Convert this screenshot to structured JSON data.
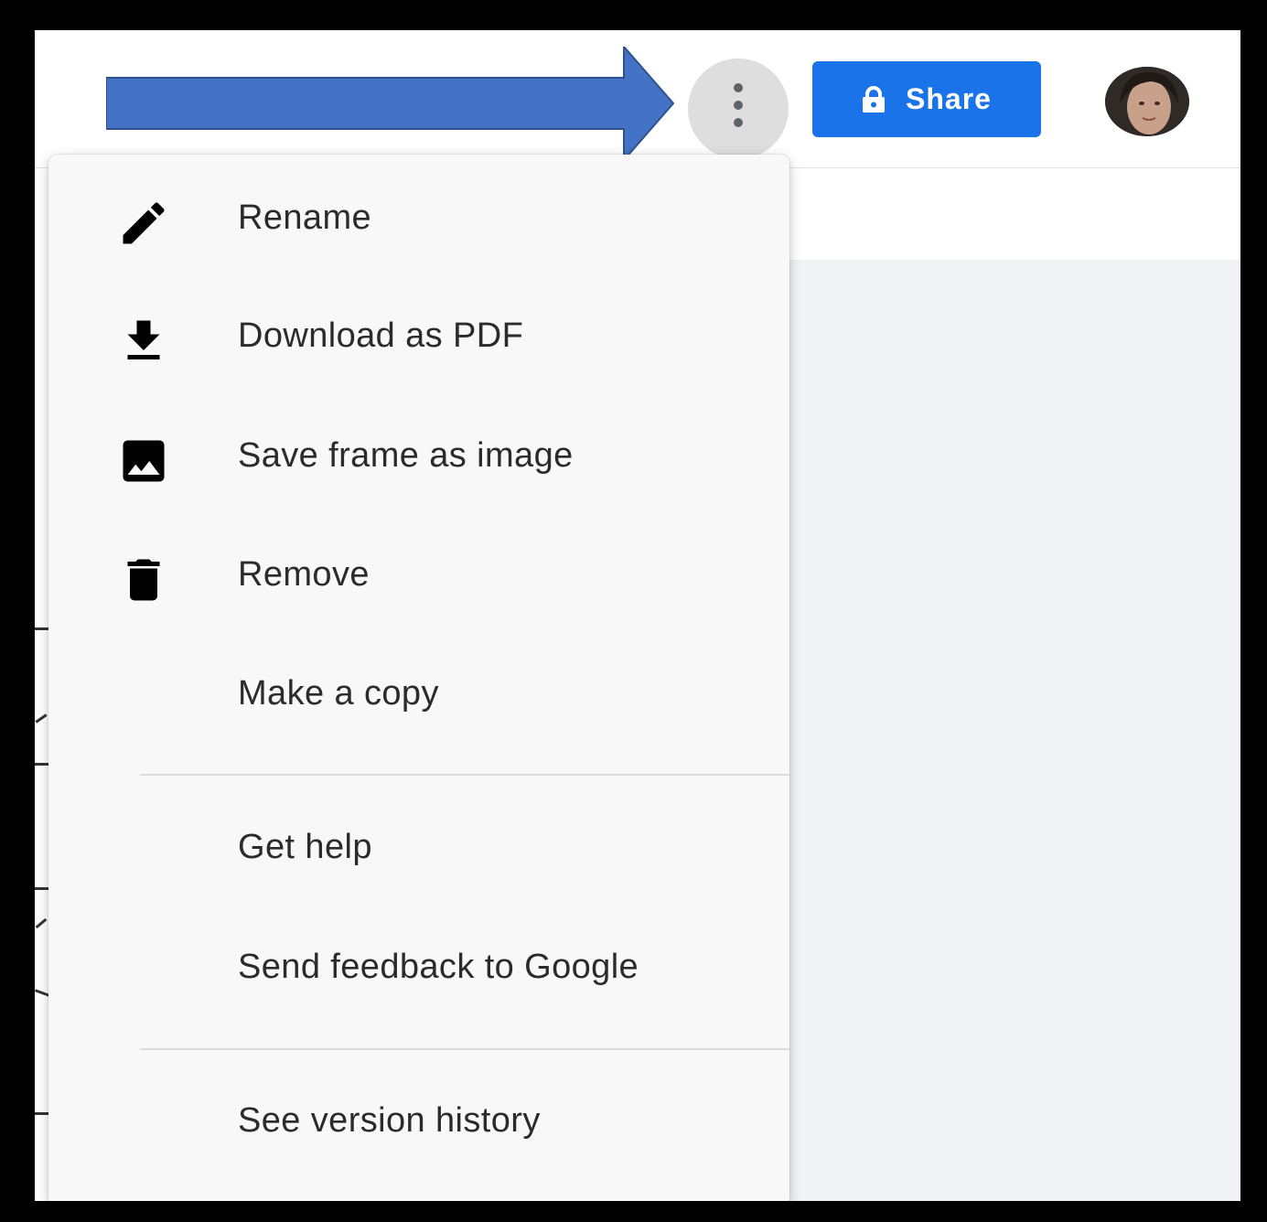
{
  "toolbar": {
    "more_icon": "more-vert-icon",
    "share_label": "Share",
    "share_icon": "lock-icon",
    "avatar": "user-avatar"
  },
  "menu": {
    "items": [
      {
        "label": "Rename",
        "icon": "pencil-icon"
      },
      {
        "label": "Download as PDF",
        "icon": "download-icon"
      },
      {
        "label": "Save frame as image",
        "icon": "image-icon"
      },
      {
        "label": "Remove",
        "icon": "trash-icon"
      },
      {
        "label": "Make a copy",
        "icon": ""
      },
      {
        "label": "Get help",
        "icon": ""
      },
      {
        "label": "Send feedback to Google",
        "icon": ""
      },
      {
        "label": "See version history",
        "icon": ""
      }
    ]
  },
  "annotation": {
    "arrow_color": "#4472c4"
  },
  "colors": {
    "primary": "#1a73e8",
    "menu_bg": "#f8f8f8",
    "canvas_bg": "#f1f3f4"
  }
}
